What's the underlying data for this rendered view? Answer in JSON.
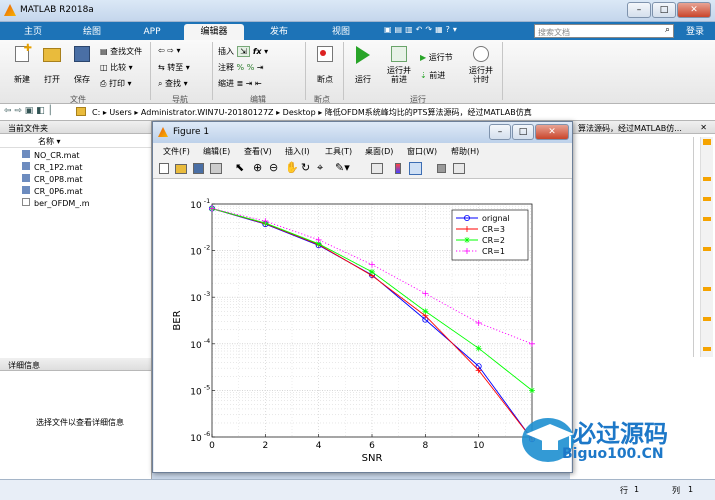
{
  "app": {
    "title": "MATLAB R2018a",
    "search_placeholder": "搜索文档",
    "login": "登录"
  },
  "tabs": [
    {
      "label": "主页"
    },
    {
      "label": "绘图"
    },
    {
      "label": "APP"
    },
    {
      "label": "编辑器"
    },
    {
      "label": "发布"
    },
    {
      "label": "视图"
    }
  ],
  "toolstrip": {
    "new": "新建",
    "open": "打开",
    "save": "保存",
    "find_files": "查找文件",
    "compare": "比较",
    "print": "打印",
    "file_group": "文件",
    "insert": "插入",
    "comment": "注释",
    "indent": "缩进",
    "fx": "fx",
    "goto": "转至",
    "find": "查找",
    "nav_group": "导航",
    "edit_group": "编辑",
    "breakpoints": "断点",
    "bp_group": "断点",
    "run": "运行",
    "run_advance": "运行并\n前进",
    "run_section": "运行节",
    "advance": "前进",
    "run_time": "运行并\n计时",
    "run_group": "运行"
  },
  "address": {
    "path": [
      "C:",
      "Users",
      "Administrator.WIN7U-20180127Z",
      "Desktop",
      "降低OFDM系统峰均比的PTS算法源码，经过MATLAB仿真"
    ]
  },
  "right_panel": {
    "title": "算法源码，经过MATLAB仿..."
  },
  "current_folder": {
    "title": "当前文件夹",
    "name_header": "名称 ▾",
    "files": [
      "NO_CR.mat",
      "CR_1P2.mat",
      "CR_0P8.mat",
      "CR_0P6.mat",
      "ber_OFDM_.m"
    ]
  },
  "details": {
    "title": "详细信息",
    "hint": "选择文件以查看详细信息"
  },
  "status": {
    "line_label": "行",
    "line": "1",
    "col_label": "列",
    "col": "1"
  },
  "figure": {
    "title": "Figure 1",
    "menus": [
      "文件(F)",
      "编辑(E)",
      "查看(V)",
      "插入(I)",
      "工具(T)",
      "桌面(D)",
      "窗口(W)",
      "帮助(H)"
    ]
  },
  "logo": {
    "text": "必过源码",
    "site": "Biguo100.CN"
  },
  "colors": {
    "tabbar": "#1d73b7",
    "orignal": "#0000ff",
    "cr3": "#ff0000",
    "cr2": "#00ff00",
    "cr1": "#ff00ff"
  },
  "chart_data": {
    "type": "line",
    "xlabel": "SNR",
    "ylabel": "BER",
    "yscale": "log",
    "xlim": [
      0,
      12
    ],
    "ylim": [
      1e-06,
      0.1
    ],
    "xticks": [
      0,
      2,
      4,
      6,
      8,
      10
    ],
    "xticklabels": [
      "0",
      "2",
      "4",
      "6",
      "8",
      "10"
    ],
    "ytick_labels": [
      {
        "v": 0.1,
        "b": "10",
        "e": "-1"
      },
      {
        "v": 0.01,
        "b": "10",
        "e": "-2"
      },
      {
        "v": 0.001,
        "b": "10",
        "e": "-3"
      },
      {
        "v": 0.0001,
        "b": "10",
        "e": "-4"
      },
      {
        "v": 1e-05,
        "b": "10",
        "e": "-5"
      },
      {
        "v": 1e-06,
        "b": "10",
        "e": "-6"
      }
    ],
    "grid": true,
    "legend_position": "top-right",
    "x": [
      0,
      2,
      4,
      6,
      8,
      10,
      12
    ],
    "series": [
      {
        "name": "orignal",
        "color": "#0000ff",
        "marker": "o",
        "dash": "solid",
        "values": [
          0.08,
          0.037,
          0.013,
          0.003,
          0.00033,
          3.3e-05,
          9e-07
        ]
      },
      {
        "name": "CR=3",
        "color": "#ff0000",
        "marker": "+",
        "dash": "solid",
        "values": [
          0.08,
          0.038,
          0.0135,
          0.0029,
          0.0004,
          2.7e-05,
          9e-07
        ]
      },
      {
        "name": "CR=2",
        "color": "#00ff00",
        "marker": "*",
        "dash": "solid",
        "values": [
          0.08,
          0.039,
          0.014,
          0.0035,
          0.0005,
          8e-05,
          1e-05
        ]
      },
      {
        "name": "CR=1",
        "color": "#ff00ff",
        "marker": "+",
        "dash": "dotted",
        "values": [
          0.08,
          0.043,
          0.017,
          0.005,
          0.0012,
          0.00028,
          0.0001
        ]
      }
    ]
  }
}
